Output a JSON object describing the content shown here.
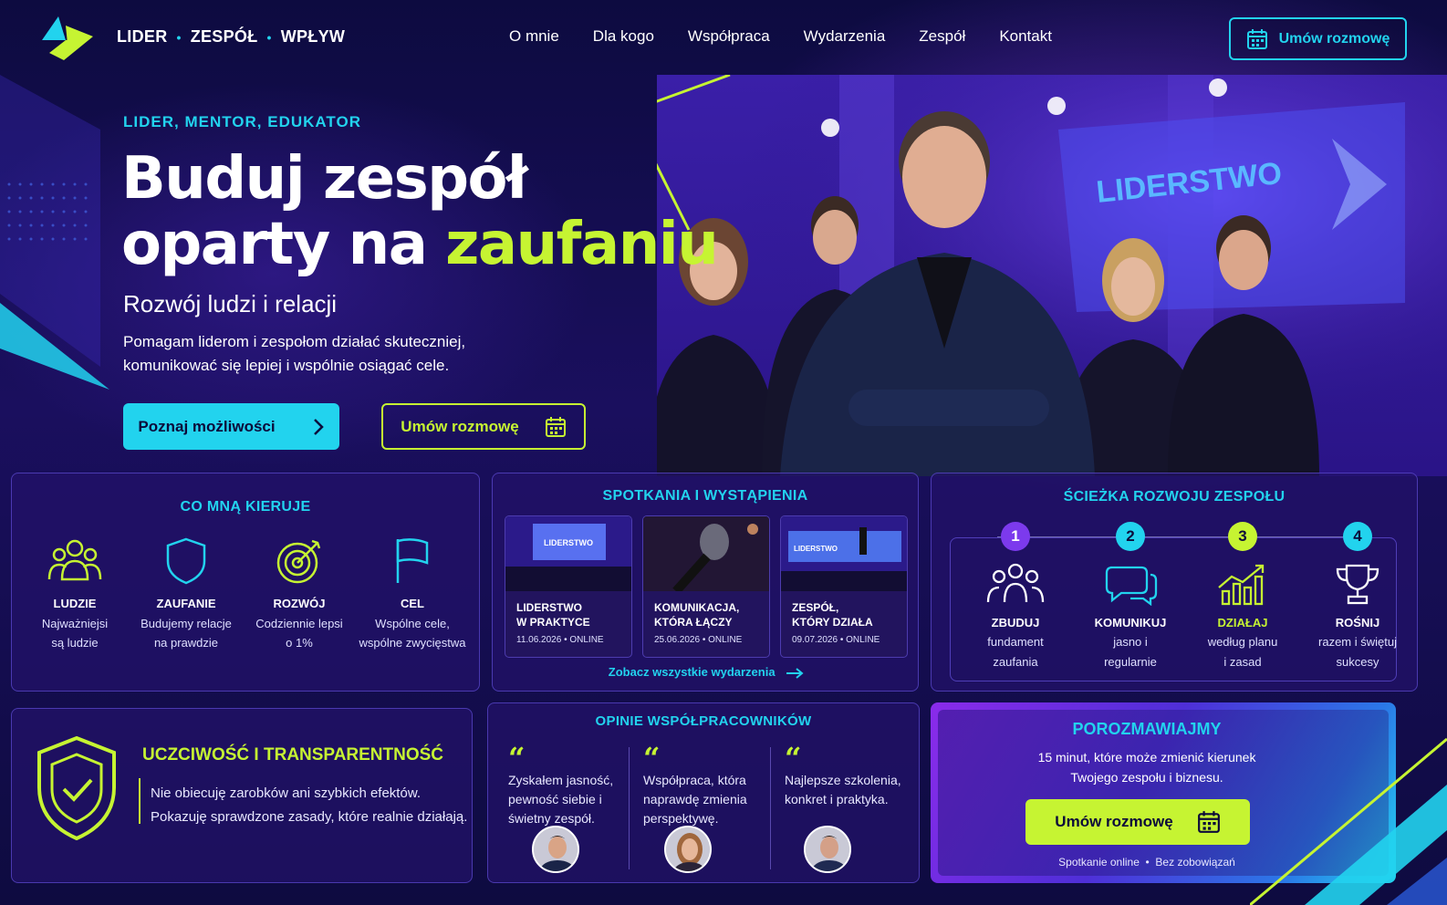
{
  "header": {
    "brand": [
      "LIDER",
      "ZESPÓŁ",
      "WPŁYW"
    ],
    "nav": [
      "O mnie",
      "Dla kogo",
      "Współpraca",
      "Wydarzenia",
      "Zespół",
      "Kontakt"
    ],
    "cta_label": "Umów rozmowę"
  },
  "hero": {
    "kicker": "LIDER, MENTOR, EDUKATOR",
    "title_line1": "Buduj zespół",
    "title_line2_plain": "oparty na ",
    "title_line2_accent": "zaufaniu",
    "subtitle": "Rozwój ludzi i relacji",
    "description": "Pomagam liderom i zespołom działać skuteczniej, komunikować się lepiej i wspólnie osiągać cele.",
    "primary_button": "Poznaj możliwości",
    "secondary_button": "Umów rozmowę",
    "stage_screen_text": "LIDERSTWO"
  },
  "values": {
    "title": "CO MNĄ KIERUJE",
    "items": [
      {
        "icon": "people-icon",
        "title": "LUDZIE",
        "line1": "Najważniejsi",
        "line2": "są ludzie"
      },
      {
        "icon": "shield-icon",
        "title": "ZAUFANIE",
        "line1": "Budujemy relacje",
        "line2": "na prawdzie"
      },
      {
        "icon": "target-icon",
        "title": "ROZWÓJ",
        "line1": "Codziennie lepsi",
        "line2": "o 1%"
      },
      {
        "icon": "flag-icon",
        "title": "CEL",
        "line1": "Wspólne cele,",
        "line2": "wspólne zwycięstwa"
      }
    ]
  },
  "events": {
    "title": "SPOTKANIA I WYSTĄPIENIA",
    "items": [
      {
        "line1": "LIDERSTWO",
        "line2": "W PRAKTYCE",
        "date": "11.06.2026",
        "mode": "ONLINE",
        "thumb_text": "LIDERSTWO"
      },
      {
        "line1": "KOMUNIKACJA,",
        "line2": "KTÓRA ŁĄCZY",
        "date": "25.06.2026",
        "mode": "ONLINE",
        "thumb_text": ""
      },
      {
        "line1": "ZESPÓŁ,",
        "line2": "KTÓRY DZIAŁA",
        "date": "09.07.2026",
        "mode": "ONLINE",
        "thumb_text": "LIDERSTWO"
      }
    ],
    "link": "Zobacz wszystkie wydarzenia"
  },
  "path": {
    "title": "ŚCIEŻKA ROZWOJU ZESPOŁU",
    "steps": [
      {
        "num": "1",
        "icon": "people-icon",
        "title": "ZBUDUJ",
        "line1": "fundament",
        "line2": "zaufania",
        "color": "#7c3aed"
      },
      {
        "num": "2",
        "icon": "chat-icon",
        "title": "KOMUNIKUJ",
        "line1": "jasno i",
        "line2": "regularnie",
        "color": "#22d3ee"
      },
      {
        "num": "3",
        "icon": "chart-icon",
        "title": "DZIAŁAJ",
        "line1": "według planu",
        "line2": "i zasad",
        "color": "#c6f432"
      },
      {
        "num": "4",
        "icon": "trophy-icon",
        "title": "ROŚNIJ",
        "line1": "razem i świętuj",
        "line2": "sukcesy",
        "color": "#22d3ee"
      }
    ]
  },
  "integrity": {
    "title": "UCZCIWOŚĆ I TRANSPARENTNOŚĆ",
    "line1": "Nie obiecuję zarobków ani szybkich efektów.",
    "line2": "Pokazuję sprawdzone zasady, które realnie działają."
  },
  "opinions": {
    "title": "OPINIE WSPÓŁPRACOWNIKÓW",
    "items": [
      {
        "text": "Zyskałem jasność, pewność siebie i świetny zespół."
      },
      {
        "text": "Współpraca, która naprawdę zmienia perspektywę."
      },
      {
        "text": "Najlepsze szkolenia, konkret i praktyka."
      }
    ]
  },
  "contact": {
    "title": "POROZMAWIAJMY",
    "line1": "15 minut, które może zmienić kierunek",
    "line2": "Twojego zespołu i biznesu.",
    "button": "Umów rozmowę",
    "note": "Spotkanie online  •  Bez zobowiązań"
  },
  "colors": {
    "accent": "#22d3ee",
    "lime": "#c6f432",
    "bg": "#0c0a3a",
    "purple": "#7c3aed"
  }
}
